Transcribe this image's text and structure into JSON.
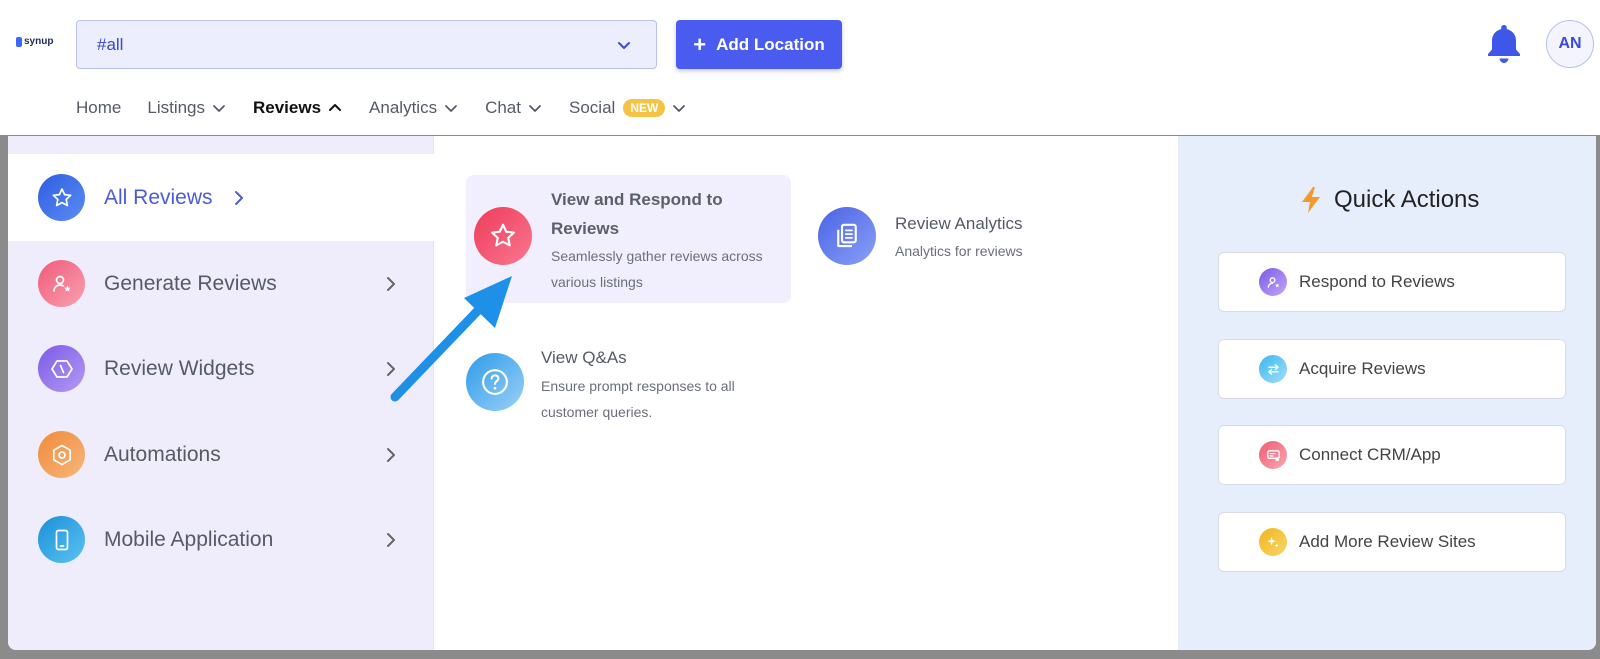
{
  "logo": {
    "text": "synup"
  },
  "location_select": {
    "value": "#all"
  },
  "add_location": {
    "label": "Add Location"
  },
  "avatar": {
    "initials": "AN"
  },
  "nav": {
    "items": [
      {
        "label": "Home"
      },
      {
        "label": "Listings"
      },
      {
        "label": "Reviews"
      },
      {
        "label": "Analytics"
      },
      {
        "label": "Chat"
      },
      {
        "label": "Social",
        "badge": "NEW"
      }
    ]
  },
  "left_menu": {
    "items": [
      {
        "label": "All Reviews",
        "icon": "star-icon"
      },
      {
        "label": "Generate Reviews",
        "icon": "user-star-icon"
      },
      {
        "label": "Review Widgets",
        "icon": "code-icon"
      },
      {
        "label": "Automations",
        "icon": "hexagon-icon"
      },
      {
        "label": "Mobile Application",
        "icon": "phone-icon"
      }
    ]
  },
  "cards": [
    {
      "title": "View and Respond to Reviews",
      "desc": "Seamlessly gather reviews across various listings",
      "icon": "star-icon"
    },
    {
      "title": "Review Analytics",
      "desc": "Analytics for reviews",
      "icon": "documents-icon"
    },
    {
      "title": "View Q&As",
      "desc": "Ensure prompt responses to all customer queries.",
      "icon": "question-icon"
    }
  ],
  "quick_actions": {
    "title": "Quick Actions",
    "items": [
      {
        "label": "Respond to Reviews",
        "icon": "user-star-icon"
      },
      {
        "label": "Acquire Reviews",
        "icon": "arrows-icon"
      },
      {
        "label": "Connect CRM/App",
        "icon": "connect-icon"
      },
      {
        "label": "Add More Review Sites",
        "icon": "sparkle-icon"
      }
    ]
  },
  "colors": {
    "accent": "#4a5cf0",
    "menu_bg": "#efedfb",
    "quick_bg": "#e6eefb",
    "badge": "#f6c445",
    "pointer_arrow": "#1e90e8"
  }
}
